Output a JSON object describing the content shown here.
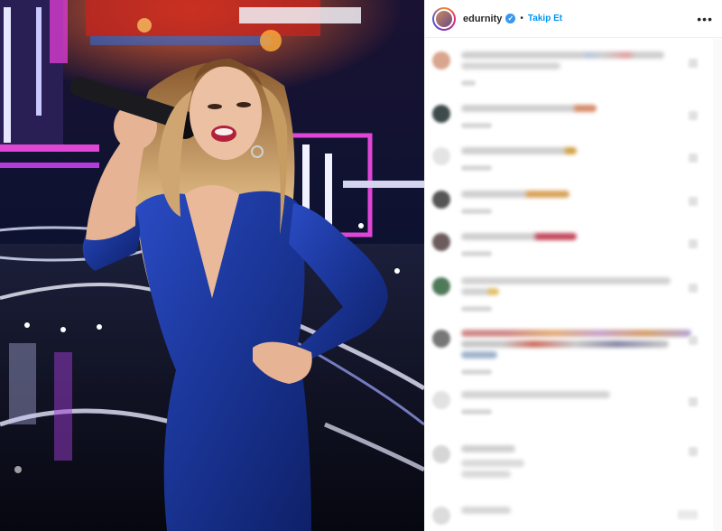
{
  "post": {
    "username": "edurnity",
    "verified_mark": "✓",
    "separator": "•",
    "follow_label": "Takip Et",
    "more_label": "•••"
  },
  "icons": [
    "verified-badge-icon",
    "more-options-icon",
    "heart-icon"
  ],
  "colors": {
    "follow": "#0095f6",
    "dress": "#1f3a9c",
    "stage_pink": "#d83bd0",
    "verified": "#3897f0"
  },
  "comments": [
    {
      "id": "c1"
    },
    {
      "id": "c2"
    },
    {
      "id": "c3"
    },
    {
      "id": "c4"
    },
    {
      "id": "c5"
    },
    {
      "id": "c6"
    },
    {
      "id": "c7"
    },
    {
      "id": "c8"
    },
    {
      "id": "c9"
    },
    {
      "id": "c10"
    }
  ]
}
